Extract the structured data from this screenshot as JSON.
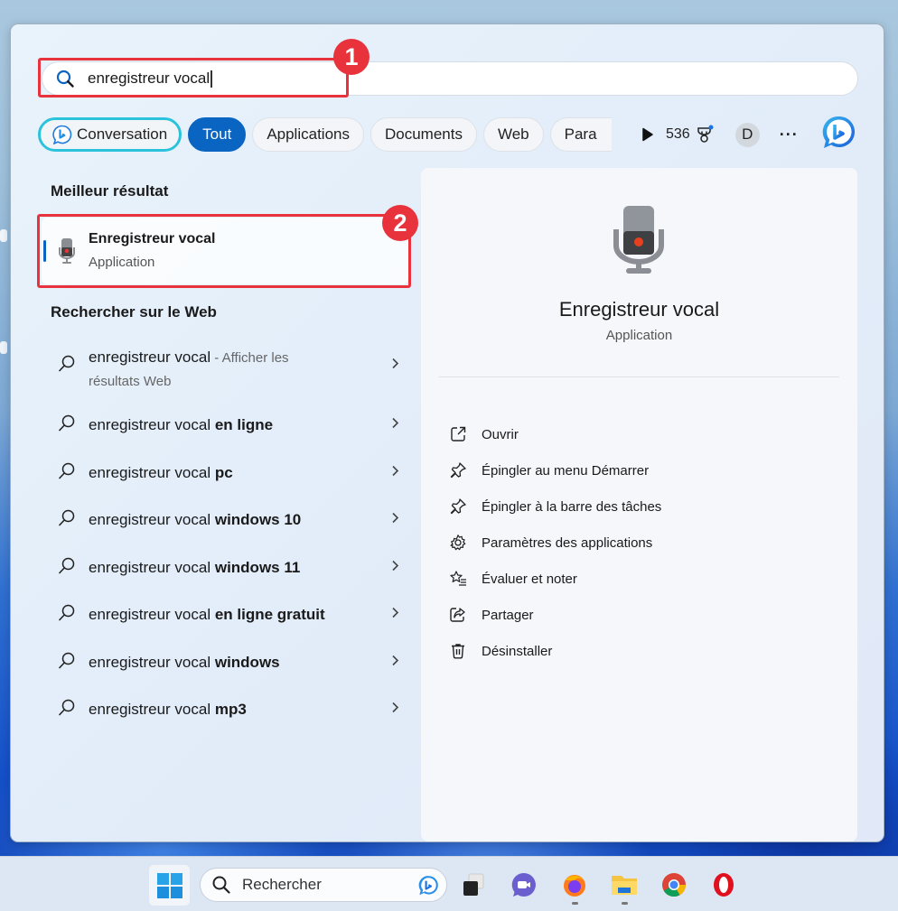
{
  "search": {
    "query": "enregistreur vocal",
    "annotation_1": "1",
    "annotation_2": "2"
  },
  "filters": [
    {
      "label": "Conversation",
      "state": "copilot"
    },
    {
      "label": "Tout",
      "state": "active"
    },
    {
      "label": "Applications",
      "state": "normal"
    },
    {
      "label": "Documents",
      "state": "normal"
    },
    {
      "label": "Web",
      "state": "normal"
    },
    {
      "label": "Para",
      "state": "clipped"
    }
  ],
  "toolbar": {
    "points": "536",
    "avatar_initial": "D",
    "more": "···"
  },
  "best_match": {
    "heading": "Meilleur résultat",
    "title": "Enregistreur vocal",
    "subtitle": "Application"
  },
  "web": {
    "heading": "Rechercher sur le Web",
    "first": {
      "query": "enregistreur vocal",
      "suffix": " - Afficher les résultats Web"
    },
    "items": [
      {
        "base": "enregistreur vocal ",
        "bold": "en ligne"
      },
      {
        "base": "enregistreur vocal ",
        "bold": "pc"
      },
      {
        "base": "enregistreur vocal ",
        "bold": "windows 10"
      },
      {
        "base": "enregistreur vocal ",
        "bold": "windows 11"
      },
      {
        "base": "enregistreur vocal ",
        "bold": "en ligne gratuit"
      },
      {
        "base": "enregistreur vocal ",
        "bold": "windows"
      },
      {
        "base": "enregistreur vocal ",
        "bold": "mp3"
      }
    ]
  },
  "detail": {
    "name": "Enregistreur vocal",
    "type": "Application",
    "actions": [
      {
        "label": "Ouvrir",
        "icon": "open-external-icon"
      },
      {
        "label": "Épingler au menu Démarrer",
        "icon": "pin-icon"
      },
      {
        "label": "Épingler à la barre des tâches",
        "icon": "pin-icon"
      },
      {
        "label": "Paramètres des applications",
        "icon": "gear-icon"
      },
      {
        "label": "Évaluer et noter",
        "icon": "star-list-icon"
      },
      {
        "label": "Partager",
        "icon": "share-icon"
      },
      {
        "label": "Désinstaller",
        "icon": "trash-icon"
      }
    ]
  },
  "taskbar": {
    "search_label": "Rechercher",
    "apps": [
      "Task View",
      "Teams",
      "Firefox",
      "File Explorer",
      "Chrome",
      "Opera"
    ]
  },
  "colors": {
    "accent": "#0a64c2",
    "annotation_red": "#e8323c",
    "copilot_ring": "#2bc3dc"
  }
}
